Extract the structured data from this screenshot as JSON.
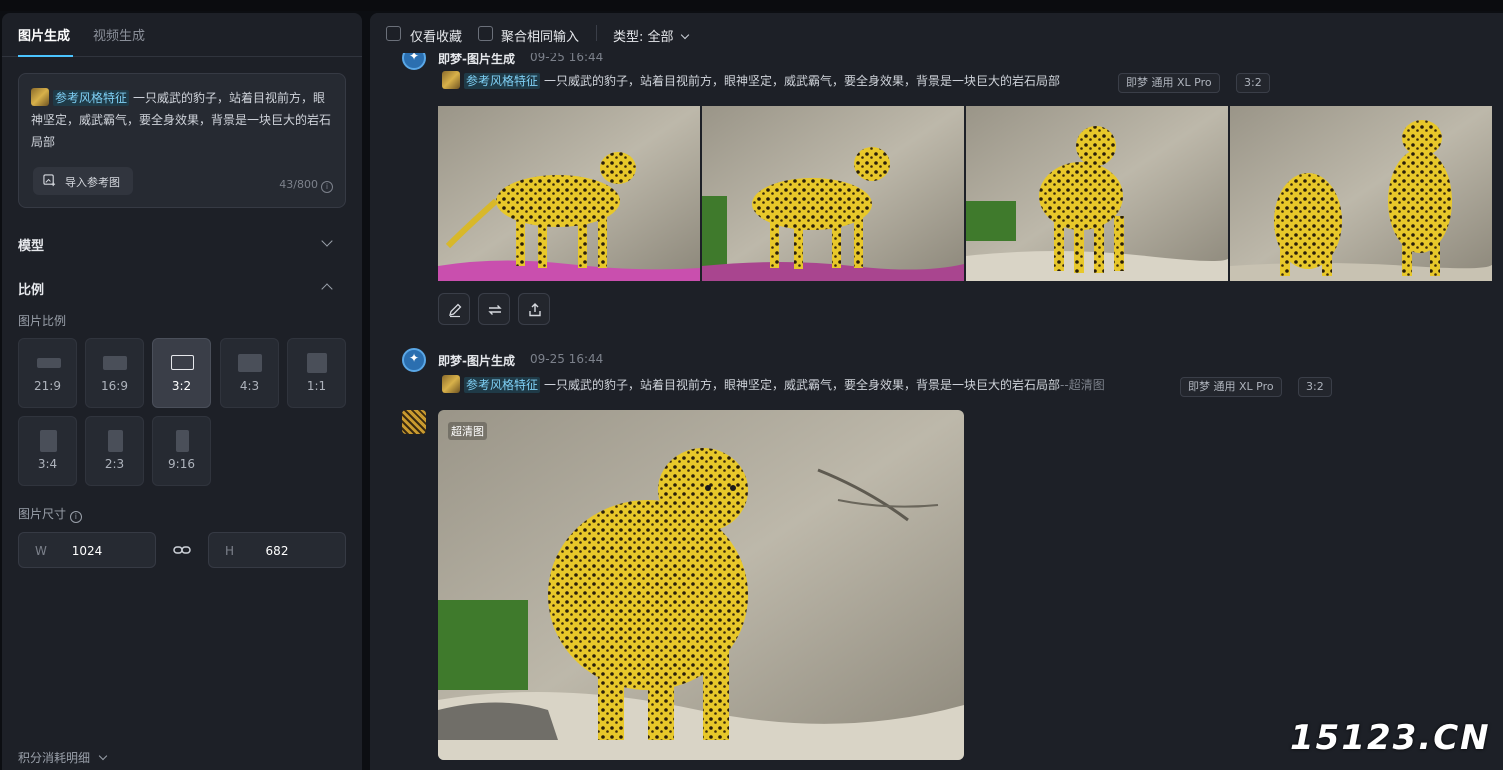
{
  "sidebar": {
    "tabs": [
      {
        "label": "图片生成",
        "active": true
      },
      {
        "label": "视频生成",
        "active": false
      }
    ],
    "prompt": {
      "ref_tag": "参考风格特征",
      "text": "一只威武的豹子，站着目视前方，眼神坚定，威武霸气，要全身效果，背景是一块巨大的岩石局部",
      "import_label": "导入参考图",
      "counter": "43/800"
    },
    "model_title": "模型",
    "ratio_title": "比例",
    "ratio_sub": "图片比例",
    "ratios": [
      {
        "label": "21:9",
        "selected": false
      },
      {
        "label": "16:9",
        "selected": false
      },
      {
        "label": "3:2",
        "selected": true
      },
      {
        "label": "4:3",
        "selected": false
      },
      {
        "label": "1:1",
        "selected": false
      },
      {
        "label": "3:4",
        "selected": false
      },
      {
        "label": "2:3",
        "selected": false
      },
      {
        "label": "9:16",
        "selected": false
      }
    ],
    "size_title": "图片尺寸",
    "width": {
      "key": "W",
      "value": "1024"
    },
    "height": {
      "key": "H",
      "value": "682"
    },
    "credits": "积分消耗明细"
  },
  "filters": {
    "favorites": "仅看收藏",
    "merge": "聚合相同输入",
    "type": "类型: 全部"
  },
  "generations": [
    {
      "name": "即梦-图片生成",
      "time": "09-25 16:44",
      "ref_tag": "参考风格特征",
      "prompt": "一只威武的豹子，站着目视前方，眼神坚定，威武霸气，要全身效果，背景是一块巨大的岩石局部",
      "suffix": "",
      "model": "即梦 通用 XL Pro",
      "ratio": "3:2"
    },
    {
      "name": "即梦-图片生成",
      "time": "09-25 16:44",
      "ref_tag": "参考风格特征",
      "prompt": "一只威武的豹子，站着目视前方，眼神坚定，威武霸气，要全身效果，背景是一块巨大的岩石局部",
      "suffix": "--超清图",
      "model": "即梦 通用 XL Pro",
      "ratio": "3:2",
      "hd_tag": "超清图"
    }
  ],
  "watermark": "15123.CN",
  "colors": {
    "accent": "#4bc4ff",
    "panel": "#1d2027",
    "leopard": "#e8c82a"
  }
}
